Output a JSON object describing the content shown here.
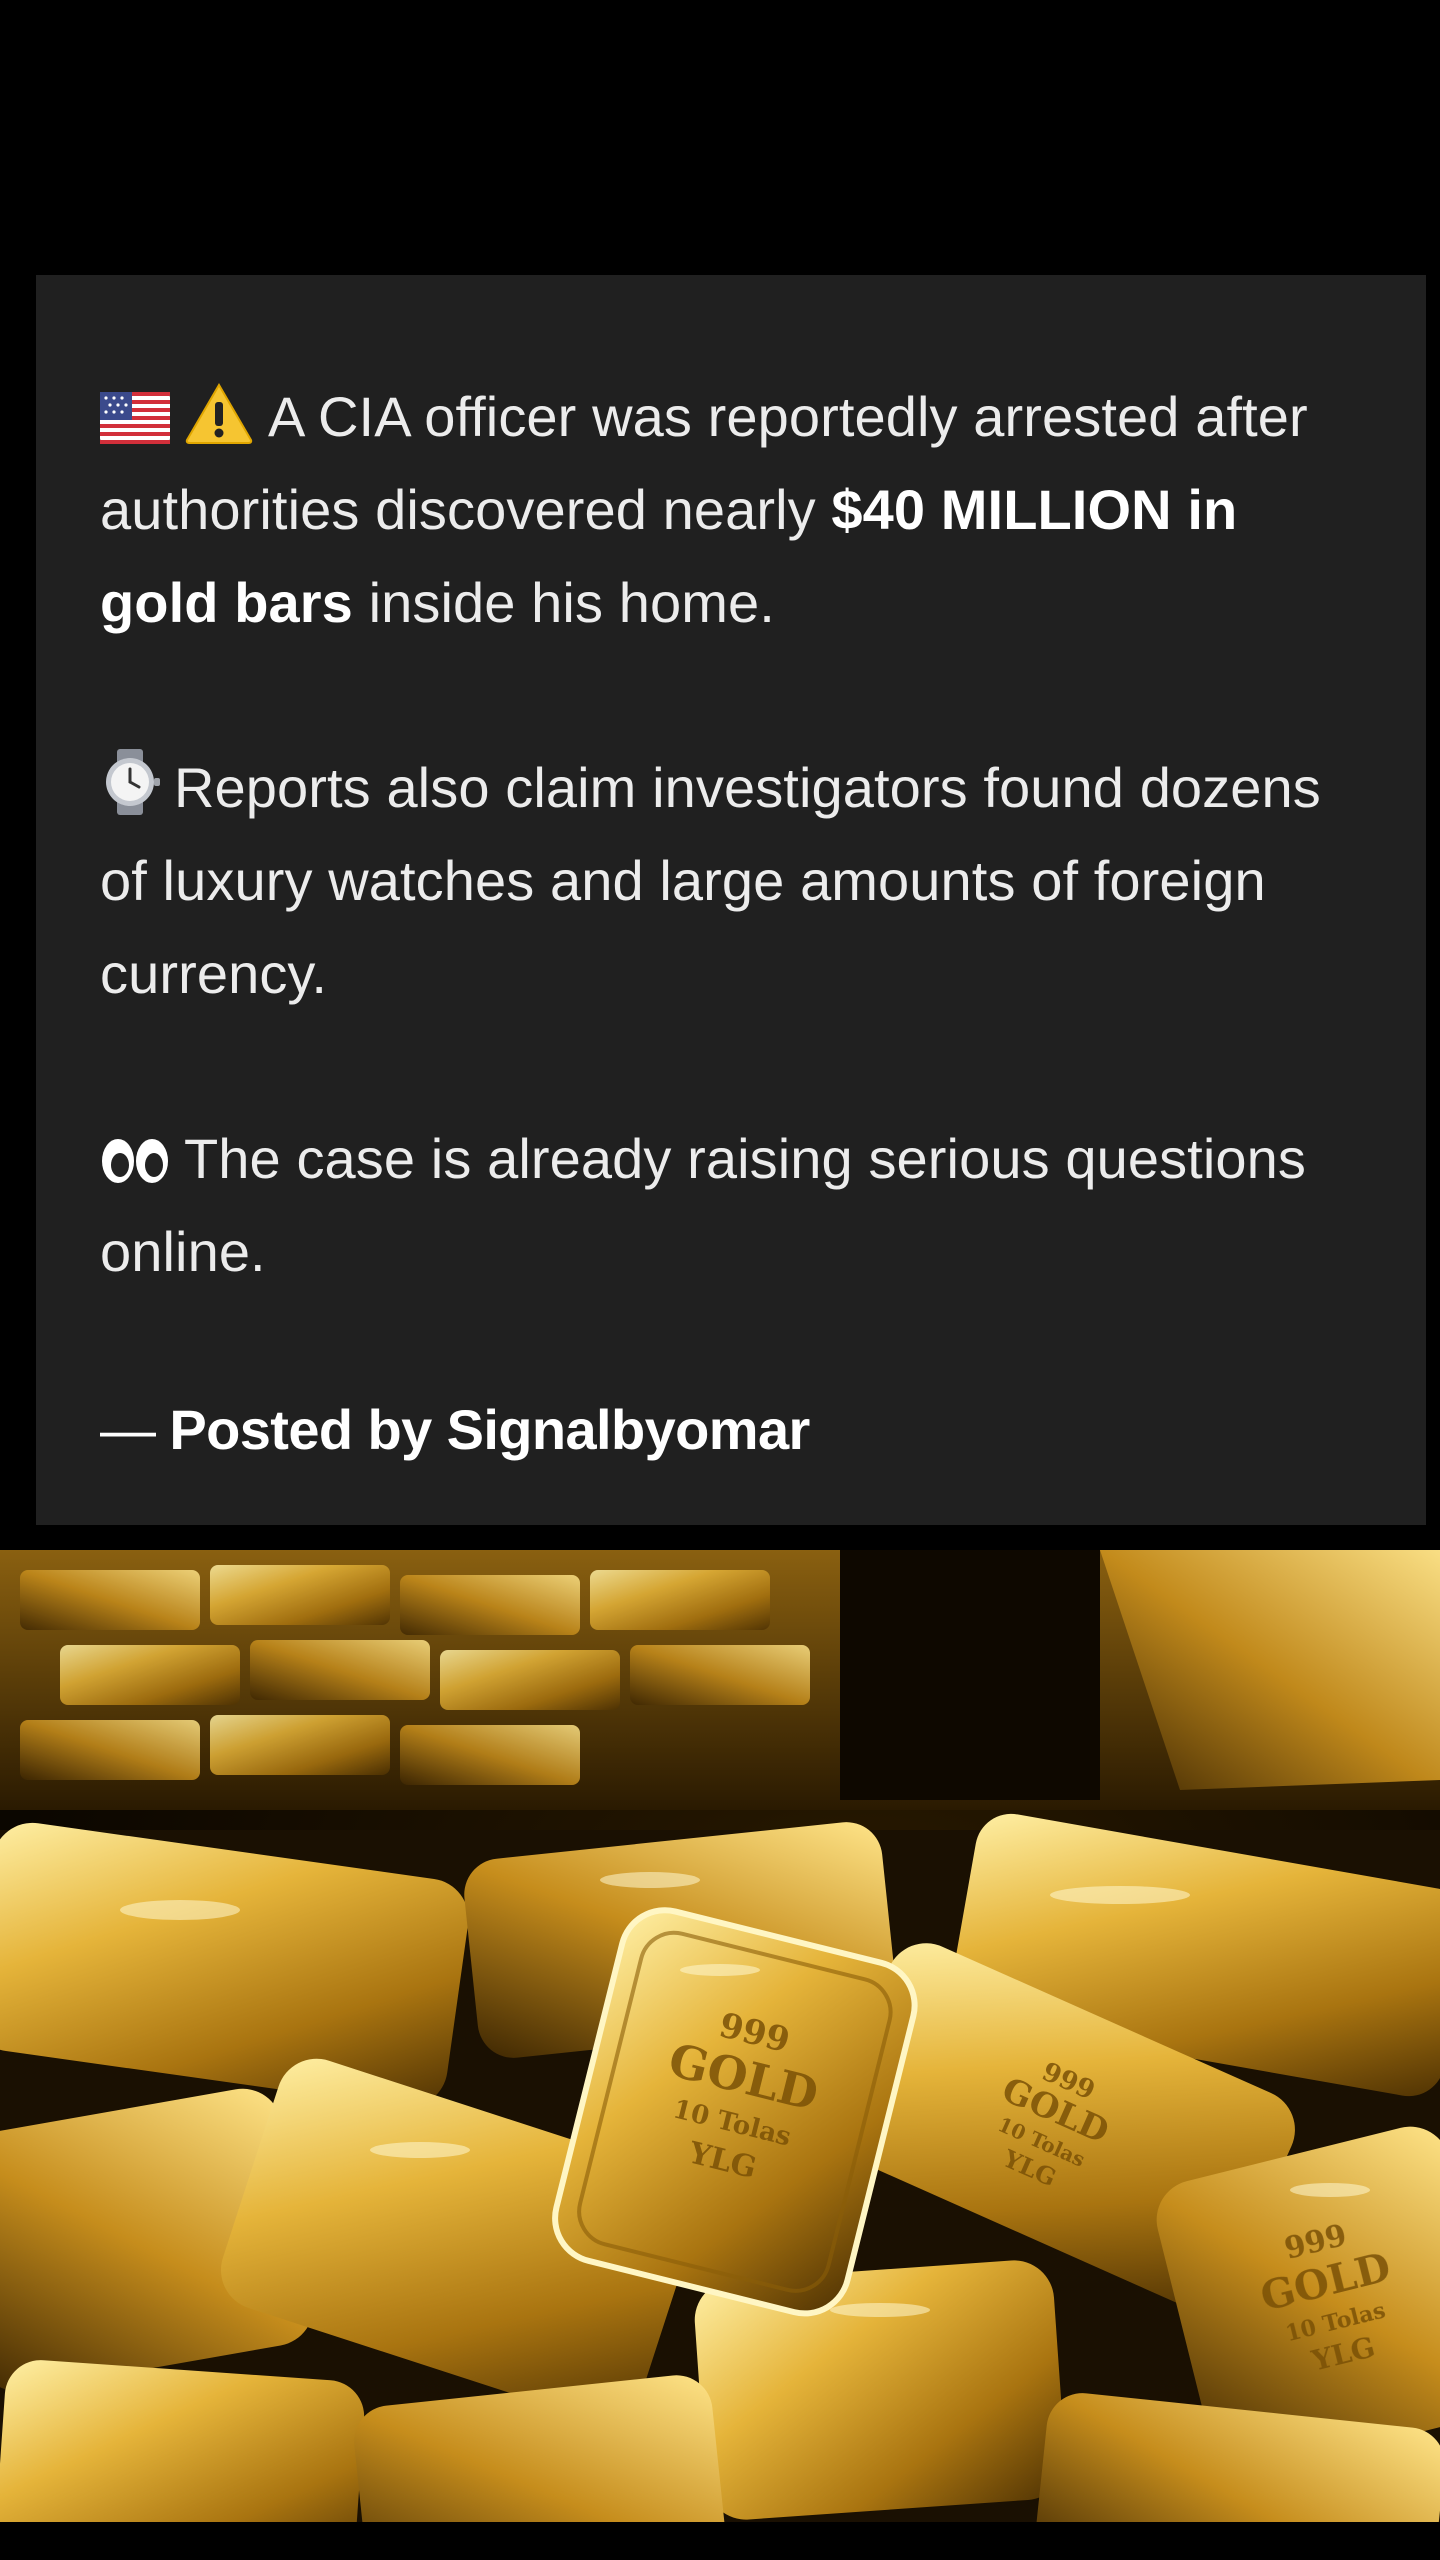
{
  "post": {
    "p1": {
      "text_a": "A CIA officer was reportedly arrested after authorities discovered nearly ",
      "bold": "$40 MILLION in gold bars",
      "text_b": " inside his home.",
      "emoji_1": "us-flag-icon",
      "emoji_2": "warning-icon"
    },
    "p2": {
      "text": "Reports also claim investigators found dozens of luxury watches and large amounts of foreign currency.",
      "emoji": "watch-icon"
    },
    "p3": {
      "text": "The case is already raising serious questions online.",
      "emoji": "eyes-icon"
    },
    "credit": {
      "dash": "—",
      "text": "Posted by Signalbyomar"
    }
  },
  "image": {
    "subject": "gold-bars",
    "bar_stamps": [
      {
        "line1": "999",
        "line2": "GOLD",
        "line3": "10 Tolas",
        "line4": "YLG"
      },
      {
        "line1": "999",
        "line2": "GOLD",
        "line3": "10 Tolas",
        "line4": "YLG"
      },
      {
        "line1": "999",
        "line2": "GOLD",
        "line3": "10 Tolas",
        "line4": "YLG"
      }
    ]
  },
  "colors": {
    "card_bg": "#202020",
    "page_bg": "#000000",
    "text": "#ececec",
    "gold_light": "#f6d774",
    "gold_mid": "#c9971f",
    "gold_dark": "#5e3d04"
  }
}
